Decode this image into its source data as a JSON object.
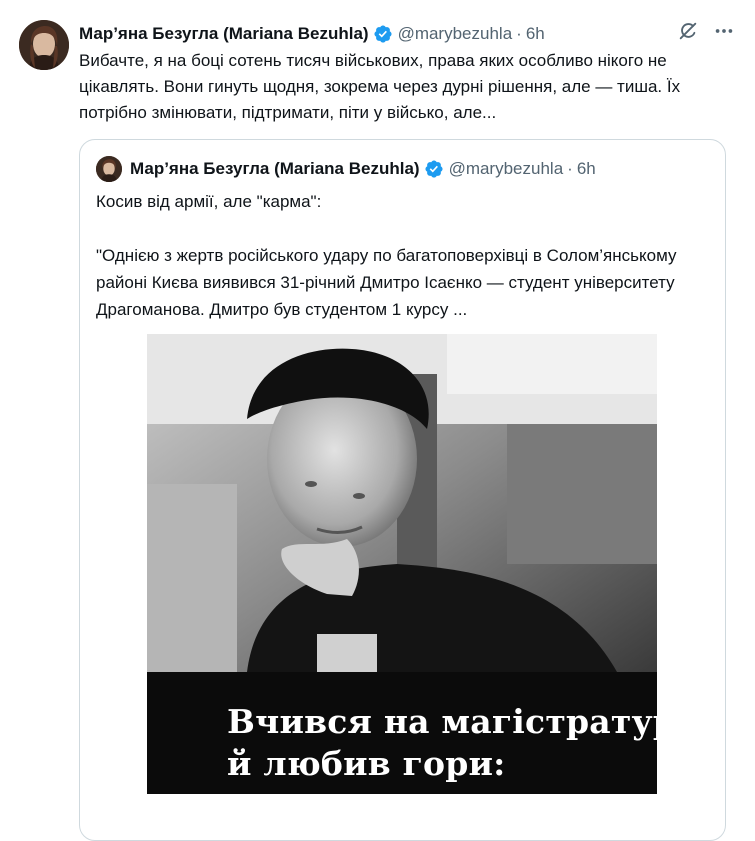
{
  "tweet": {
    "author_name": "Мар’яна Безугла (Mariana Bezuhla)",
    "handle": "@marybezuhla",
    "separator": "·",
    "time": "6h",
    "text": "Вибачте, я на боці сотень тисяч військових, права яких особливо нікого не цікавлять. Вони гинуть щодня, зокрема через дурні рішення, але — тиша. Їх потрібно змінювати, підтримати, піти у військо, але..."
  },
  "quote": {
    "author_name": "Мар’яна Безугла (Mariana Bezuhla)",
    "handle": "@marybezuhla",
    "separator": "·",
    "time": "6h",
    "line1": "Косив від армії, але \"карма\":",
    "line2": "\"Однією з жертв російського удару по багатоповерхівці в Солом’янському районі Києва виявився 31-річний Дмитро Ісаєнко — студент університету Драгоманова. Дмитро був студентом 1 курсу ...",
    "image_caption_line1": "Вчився на магістратурі",
    "image_caption_line2": "й любив гори:"
  },
  "icons": {
    "verified": "verified-badge-icon",
    "grok": "grok-icon",
    "more": "more-icon"
  },
  "colors": {
    "verified": "#1d9bf0",
    "secondary_text": "#536471",
    "border": "#cfd9de"
  }
}
